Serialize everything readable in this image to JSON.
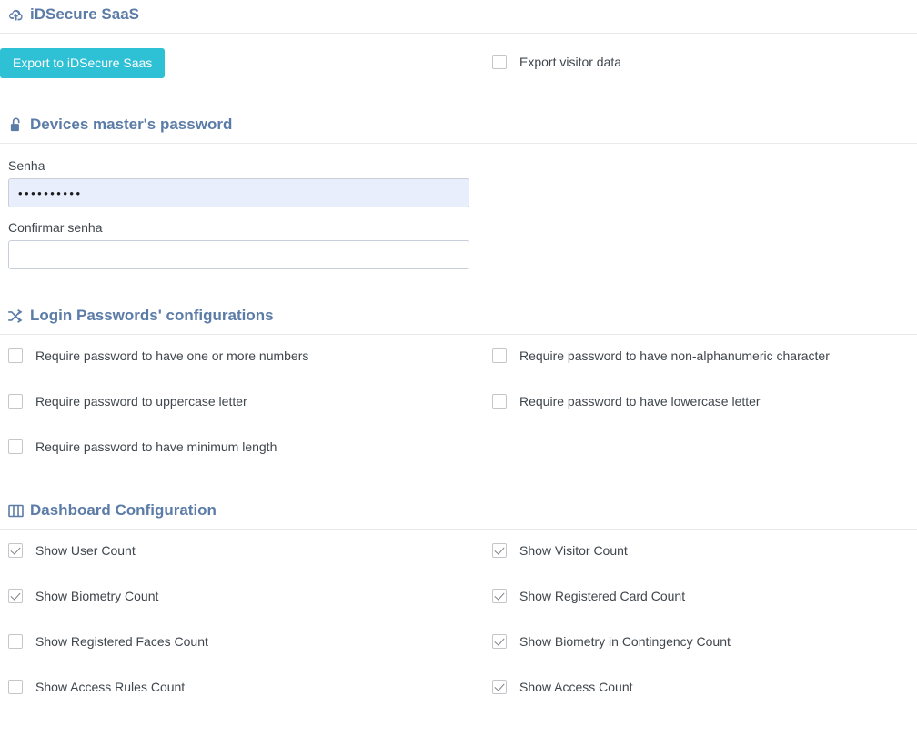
{
  "sections": [
    {
      "id": "idsecure-saas",
      "title": "iDSecure SaaS",
      "icon": "cloud-upload-icon",
      "export_button_label": "Export to iDSecure Saas",
      "checkbox": {
        "label": "Export visitor data",
        "checked": false
      }
    },
    {
      "id": "devices-master-password",
      "title": "Devices master's password",
      "icon": "lock-open-icon",
      "password_label": "Senha",
      "password_value": "••••••••••",
      "password_placeholder": "",
      "confirm_label": "Confirmar senha",
      "confirm_value": "",
      "confirm_placeholder": ""
    },
    {
      "id": "login-passwords-configurations",
      "title": "Login Passwords' configurations",
      "icon": "shuffle-icon",
      "options": [
        {
          "label": "Require password to have one or more numbers",
          "checked": false
        },
        {
          "label": "Require password to have non-alphanumeric character",
          "checked": false
        },
        {
          "label": "Require password to uppercase letter",
          "checked": false
        },
        {
          "label": "Require password to have lowercase letter",
          "checked": false
        },
        {
          "label": "Require password to have minimum length",
          "checked": false
        }
      ]
    },
    {
      "id": "dashboard-configuration",
      "title": "Dashboard Configuration",
      "icon": "columns-icon",
      "options": [
        {
          "label": "Show User Count",
          "checked": true
        },
        {
          "label": "Show Visitor Count",
          "checked": true
        },
        {
          "label": "Show Biometry Count",
          "checked": true
        },
        {
          "label": "Show Registered Card Count",
          "checked": true
        },
        {
          "label": "Show Registered Faces Count",
          "checked": false
        },
        {
          "label": "Show Biometry in Contingency Count",
          "checked": true
        },
        {
          "label": "Show Access Rules Count",
          "checked": false
        },
        {
          "label": "Show Access Count",
          "checked": true
        }
      ]
    }
  ],
  "colors": {
    "heading": "#5c7ca8",
    "primary_button": "#2ec0d4",
    "autofill_field": "#e8eefb",
    "divider": "#e8eaed",
    "body_text": "#3f464d"
  }
}
